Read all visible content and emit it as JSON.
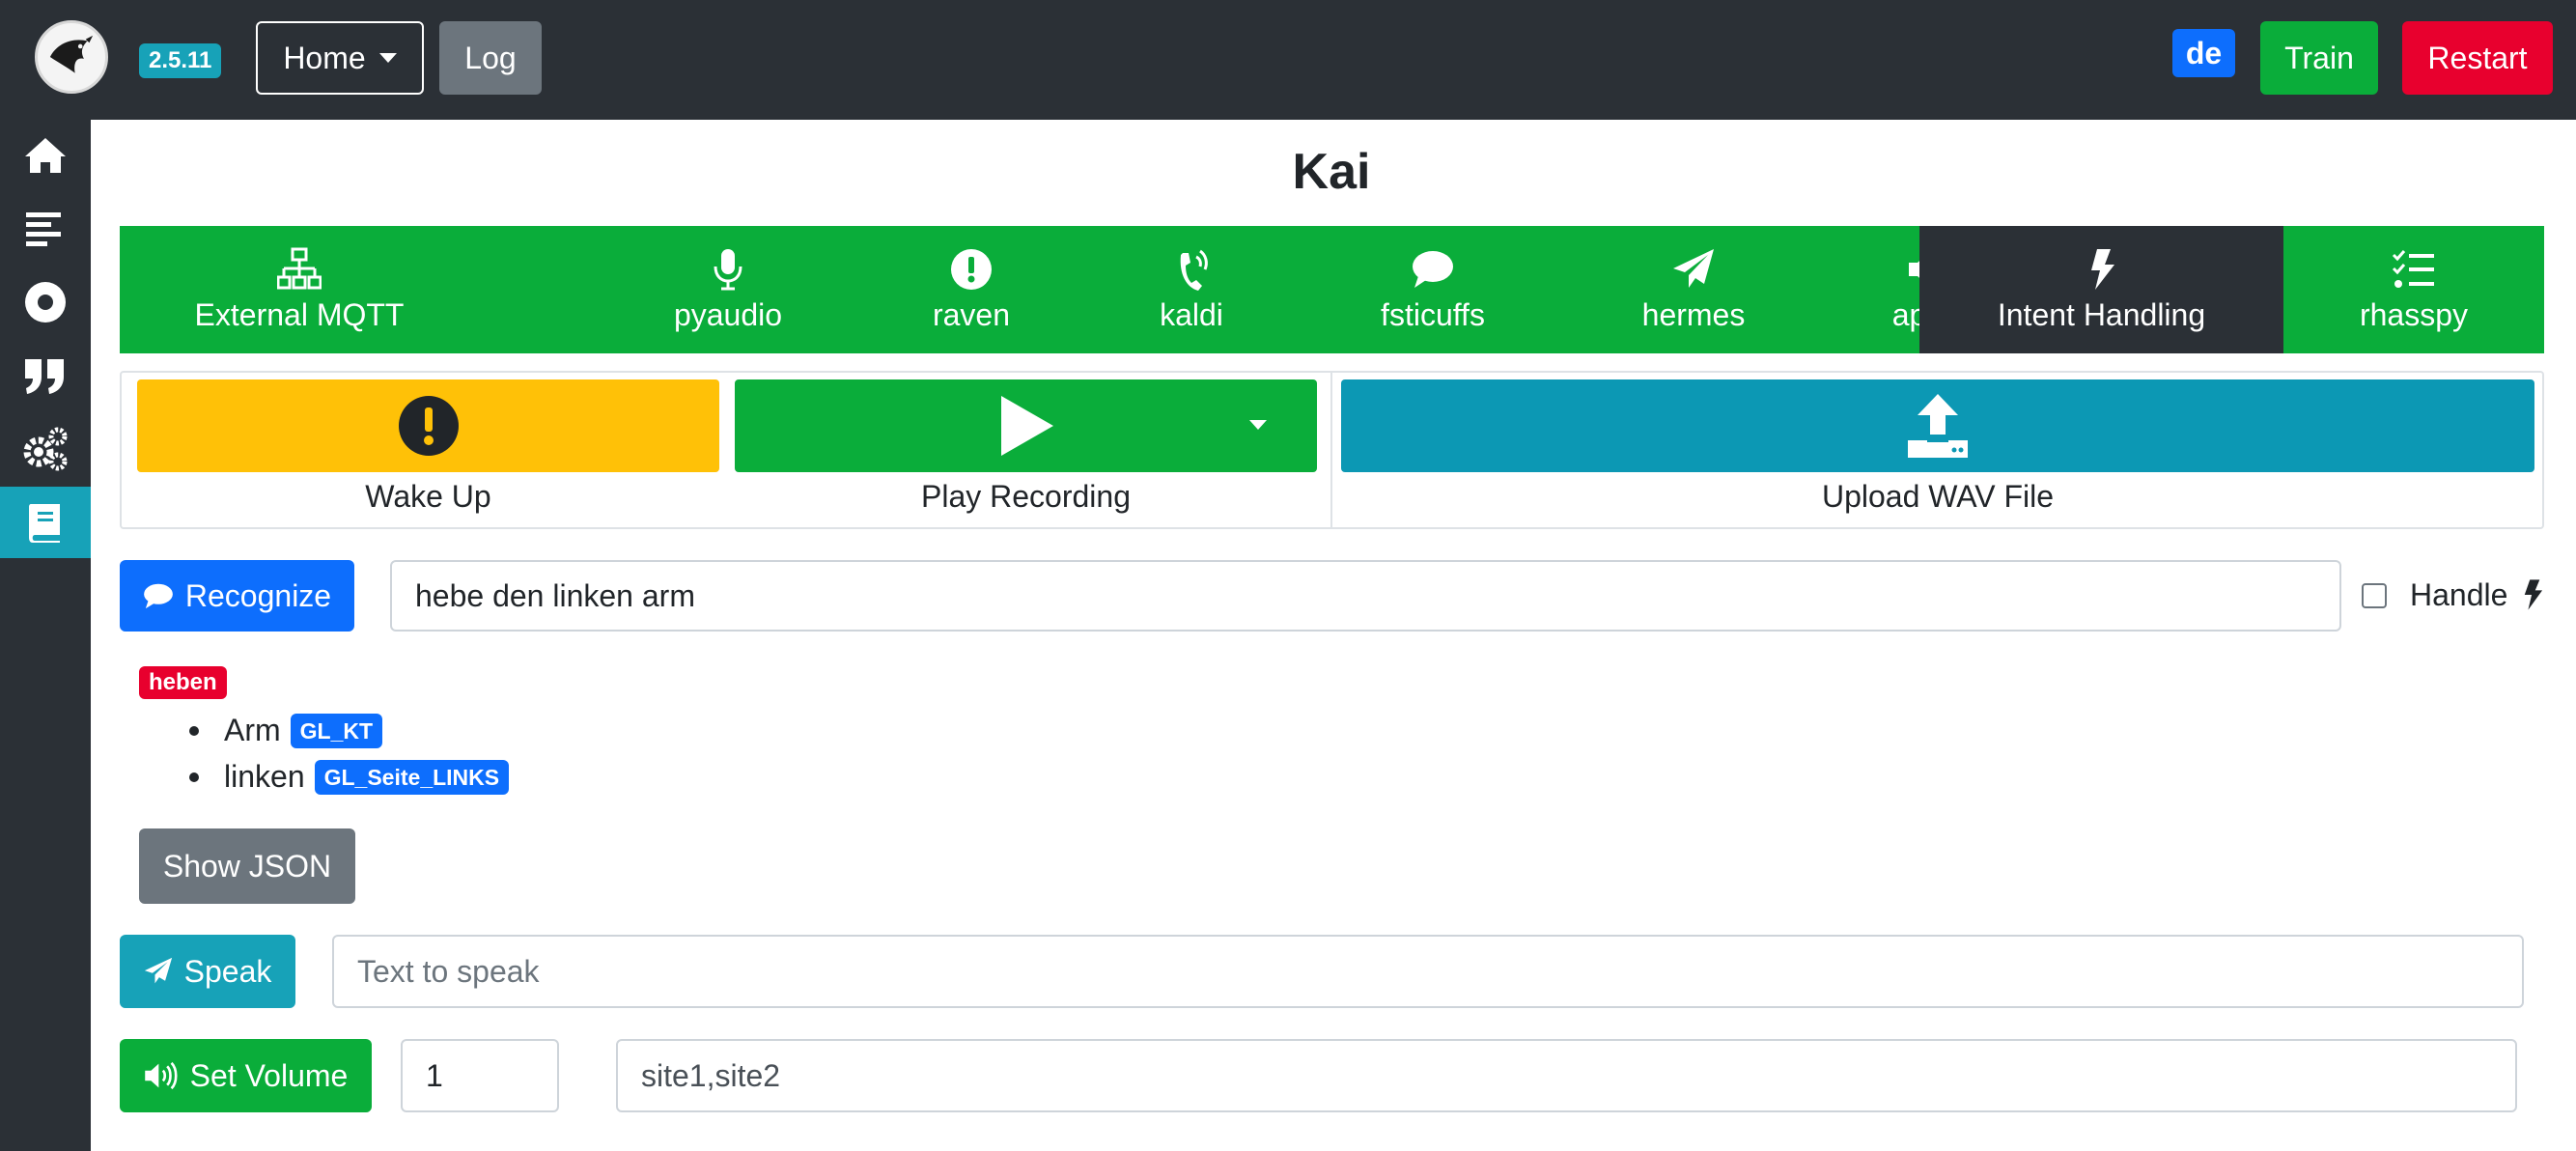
{
  "navbar": {
    "version": "2.5.11",
    "home_label": "Home",
    "log_label": "Log",
    "language": "de",
    "train_label": "Train",
    "restart_label": "Restart"
  },
  "sidebar": {
    "items": [
      {
        "icon": "home-icon"
      },
      {
        "icon": "align-left-icon"
      },
      {
        "icon": "record-icon"
      },
      {
        "icon": "quote-icon"
      },
      {
        "icon": "cogs-icon"
      },
      {
        "icon": "book-icon",
        "active": true
      }
    ]
  },
  "page": {
    "title": "Kai"
  },
  "services": [
    {
      "label": "External MQTT",
      "icon": "network-icon"
    },
    {
      "label": "pyaudio",
      "icon": "microphone-icon"
    },
    {
      "label": "raven",
      "icon": "exclamation-icon"
    },
    {
      "label": "kaldi",
      "icon": "phone-volume-icon"
    },
    {
      "label": "fsticuffs",
      "icon": "comment-icon"
    },
    {
      "label": "hermes",
      "icon": "paper-plane-icon"
    },
    {
      "label": "aplay",
      "icon": "volume-up-icon"
    },
    {
      "label": "Intent Handling",
      "icon": "bolt-icon",
      "active": true
    },
    {
      "label": "rhasspy",
      "icon": "tasks-icon"
    }
  ],
  "recording": {
    "wake_up_label": "Wake Up",
    "play_recording_label": "Play Recording",
    "upload_wav_label": "Upload WAV File"
  },
  "recognize": {
    "button_label": "Recognize",
    "input_value": "hebe den linken arm",
    "handle_label": "Handle",
    "handle_checked": false
  },
  "result": {
    "intent": "heben",
    "entities": [
      {
        "value": "Arm",
        "entity": "GL_KT"
      },
      {
        "value": "linken",
        "entity": "GL_Seite_LINKS"
      }
    ],
    "show_json_label": "Show JSON"
  },
  "speak": {
    "button_label": "Speak",
    "placeholder": "Text to speak"
  },
  "volume": {
    "button_label": "Set Volume",
    "value": "1",
    "sites_value": "site1,site2"
  },
  "colors": {
    "navbar": "#2b3036",
    "success": "#0aad3a",
    "danger": "#e8002e",
    "primary": "#0d6efd",
    "info": "#17a2b8",
    "warning": "#ffc107",
    "secondary": "#6c757d"
  }
}
